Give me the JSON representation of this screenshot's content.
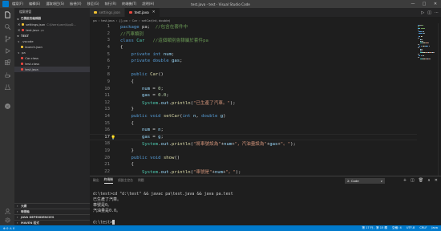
{
  "window": {
    "title": "test.java - test - Visual Studio Code",
    "menu": [
      "檔案(F)",
      "編輯(E)",
      "選取項目(S)",
      "檢視(V)",
      "移至(G)",
      "執行(R)",
      "終端機(T)",
      "說明(H)"
    ],
    "controls": [
      "minimize",
      "maximize",
      "close"
    ]
  },
  "activity_bar": [
    "explorer-icon",
    "search-icon",
    "source-control-icon",
    "run-debug-icon",
    "extensions-icon",
    "java-icon",
    "testing-icon",
    "remote-icon",
    "account-icon",
    "settings-icon"
  ],
  "sidebar": {
    "header": "檔案總管",
    "open_editors_title": "已開啟的編輯器",
    "open_editors": [
      {
        "name": "settings.json",
        "path": "C:\\Users\\user\\AppD...",
        "color": "#f1c232"
      },
      {
        "name": "test.java",
        "path": "pa",
        "color": "#e8473f"
      }
    ],
    "workspace_title": "TEST",
    "tree": [
      {
        "label": ".vscode",
        "kind": "folder",
        "depth": 1,
        "expanded": true
      },
      {
        "label": "launch.json",
        "kind": "file",
        "depth": 2,
        "color": "#f1c232"
      },
      {
        "label": "pa",
        "kind": "folder",
        "depth": 1,
        "expanded": true
      },
      {
        "label": "Car.class",
        "kind": "file",
        "depth": 2,
        "color": "#e8473f"
      },
      {
        "label": "test.class",
        "kind": "file",
        "depth": 2,
        "color": "#e8473f"
      },
      {
        "label": "test.java",
        "kind": "file",
        "depth": 2,
        "color": "#e8473f",
        "active": true
      }
    ],
    "bottom_sections": [
      "大綱",
      "時間軸",
      "JAVA DEPENDENCIES",
      "MAVEN 程式"
    ]
  },
  "tabs": [
    {
      "label": "settings.json",
      "color": "#f1c232",
      "active": false
    },
    {
      "label": "test.java",
      "color": "#e8473f",
      "active": true
    }
  ],
  "breadcrumb": [
    "pa",
    "test.java",
    "{} pa",
    "Car",
    "setCar(int, double)"
  ],
  "editor": {
    "current_line": 17,
    "lightbulb_line": 17,
    "lines": [
      {
        "n": 1,
        "t": [
          [
            "kw",
            "package"
          ],
          [
            "pl",
            " pa;  "
          ],
          [
            "cmt",
            "//包含在套件中"
          ]
        ]
      },
      {
        "n": 2,
        "t": [
          [
            "cmt",
            "//汽車類別"
          ]
        ]
      },
      {
        "n": 3,
        "t": [
          [
            "kw",
            "class"
          ],
          [
            "pl",
            " "
          ],
          [
            "ty",
            "Car"
          ],
          [
            "pl",
            "   "
          ],
          [
            "cmt",
            "//這個類別會隸屬於套件pa"
          ]
        ]
      },
      {
        "n": 4,
        "t": [
          [
            "pl",
            "{"
          ]
        ]
      },
      {
        "n": 5,
        "t": [
          [
            "pl",
            "    "
          ],
          [
            "kw",
            "private"
          ],
          [
            "pl",
            " "
          ],
          [
            "kw",
            "int"
          ],
          [
            "pl",
            " "
          ],
          [
            "var",
            "num"
          ],
          [
            "pl",
            ";"
          ]
        ]
      },
      {
        "n": 6,
        "t": [
          [
            "pl",
            "    "
          ],
          [
            "kw",
            "private"
          ],
          [
            "pl",
            " "
          ],
          [
            "kw",
            "double"
          ],
          [
            "pl",
            " "
          ],
          [
            "var",
            "gas"
          ],
          [
            "pl",
            ";"
          ]
        ]
      },
      {
        "n": 7,
        "t": []
      },
      {
        "n": 8,
        "t": [
          [
            "pl",
            "    "
          ],
          [
            "kw",
            "public"
          ],
          [
            "pl",
            " "
          ],
          [
            "fn",
            "Car"
          ],
          [
            "pl",
            "()"
          ]
        ]
      },
      {
        "n": 9,
        "t": [
          [
            "pl",
            "    {"
          ]
        ]
      },
      {
        "n": 10,
        "t": [
          [
            "pl",
            "        "
          ],
          [
            "var",
            "num"
          ],
          [
            "pl",
            " = "
          ],
          [
            "num",
            "0"
          ],
          [
            "pl",
            ";"
          ]
        ]
      },
      {
        "n": 11,
        "t": [
          [
            "pl",
            "        "
          ],
          [
            "var",
            "gas"
          ],
          [
            "pl",
            " = "
          ],
          [
            "num",
            "0.0"
          ],
          [
            "pl",
            ";"
          ]
        ]
      },
      {
        "n": 12,
        "t": [
          [
            "pl",
            "        "
          ],
          [
            "ty",
            "System"
          ],
          [
            "pl",
            "."
          ],
          [
            "var",
            "out"
          ],
          [
            "pl",
            "."
          ],
          [
            "fn",
            "println"
          ],
          [
            "pl",
            "("
          ],
          [
            "str",
            "\"已生產了汽車。\""
          ],
          [
            "pl",
            ");"
          ]
        ]
      },
      {
        "n": 13,
        "t": [
          [
            "pl",
            "    }"
          ]
        ]
      },
      {
        "n": 14,
        "t": [
          [
            "pl",
            "    "
          ],
          [
            "kw",
            "public"
          ],
          [
            "pl",
            " "
          ],
          [
            "kw",
            "void"
          ],
          [
            "pl",
            " "
          ],
          [
            "fn",
            "setCar"
          ],
          [
            "pl",
            "("
          ],
          [
            "kw",
            "int"
          ],
          [
            "pl",
            " "
          ],
          [
            "var",
            "n"
          ],
          [
            "pl",
            ", "
          ],
          [
            "kw",
            "double"
          ],
          [
            "pl",
            " "
          ],
          [
            "var",
            "g"
          ],
          [
            "pl",
            ")"
          ]
        ]
      },
      {
        "n": 15,
        "t": [
          [
            "pl",
            "    {"
          ]
        ]
      },
      {
        "n": 16,
        "t": [
          [
            "pl",
            "        "
          ],
          [
            "var",
            "num"
          ],
          [
            "pl",
            " = "
          ],
          [
            "var",
            "n"
          ],
          [
            "pl",
            ";"
          ]
        ]
      },
      {
        "n": 17,
        "t": [
          [
            "pl",
            "        "
          ],
          [
            "var",
            "gas"
          ],
          [
            "pl",
            " = "
          ],
          [
            "var",
            "g"
          ],
          [
            "pl",
            ";"
          ]
        ]
      },
      {
        "n": 18,
        "t": [
          [
            "pl",
            "        "
          ],
          [
            "ty",
            "System"
          ],
          [
            "pl",
            "."
          ],
          [
            "var",
            "out"
          ],
          [
            "pl",
            "."
          ],
          [
            "fn",
            "println"
          ],
          [
            "pl",
            "("
          ],
          [
            "str",
            "\"將車號設為\""
          ],
          [
            "pl",
            "+"
          ],
          [
            "var",
            "num"
          ],
          [
            "pl",
            "+"
          ],
          [
            "str",
            "\"，汽油量設為\""
          ],
          [
            "pl",
            "+"
          ],
          [
            "var",
            "gas"
          ],
          [
            "pl",
            "+"
          ],
          [
            "str",
            "\"。\""
          ],
          [
            "pl",
            ");"
          ]
        ]
      },
      {
        "n": 19,
        "t": [
          [
            "pl",
            "    }"
          ]
        ]
      },
      {
        "n": 20,
        "t": [
          [
            "pl",
            "    "
          ],
          [
            "kw",
            "public"
          ],
          [
            "pl",
            " "
          ],
          [
            "kw",
            "void"
          ],
          [
            "pl",
            " "
          ],
          [
            "fn",
            "show"
          ],
          [
            "pl",
            "()"
          ]
        ]
      },
      {
        "n": 21,
        "t": [
          [
            "pl",
            "    {"
          ]
        ]
      },
      {
        "n": 22,
        "t": [
          [
            "pl",
            "        "
          ],
          [
            "ty",
            "System"
          ],
          [
            "pl",
            "."
          ],
          [
            "var",
            "out"
          ],
          [
            "pl",
            "."
          ],
          [
            "fn",
            "println"
          ],
          [
            "pl",
            "("
          ],
          [
            "str",
            "\"車號是\""
          ],
          [
            "pl",
            "+"
          ],
          [
            "var",
            "num"
          ],
          [
            "pl",
            "+"
          ],
          [
            "str",
            "\"。\""
          ],
          [
            "pl",
            ");"
          ]
        ]
      }
    ]
  },
  "panel": {
    "tabs": [
      {
        "label": "輸出",
        "active": false
      },
      {
        "label": "終端機",
        "active": true
      },
      {
        "label": "偵錯主控台",
        "active": false
      },
      {
        "label": "問題",
        "active": false
      }
    ],
    "terminal_select": "2: Code",
    "terminal_lines": [
      "",
      "d:\\test>cd \"d:\\test\" && javac pa\\test.java && java pa.test",
      "已生產了汽車。",
      "車號是0。",
      "汽油量是0.0。",
      "",
      "d:\\test>"
    ]
  },
  "statusbar": {
    "left": [
      "⊗ 0  ⚠ 0"
    ],
    "right": [
      "第 17 行，第 15 欄",
      "空格: 4",
      "UTF-8",
      "CRLF",
      "Java"
    ]
  }
}
